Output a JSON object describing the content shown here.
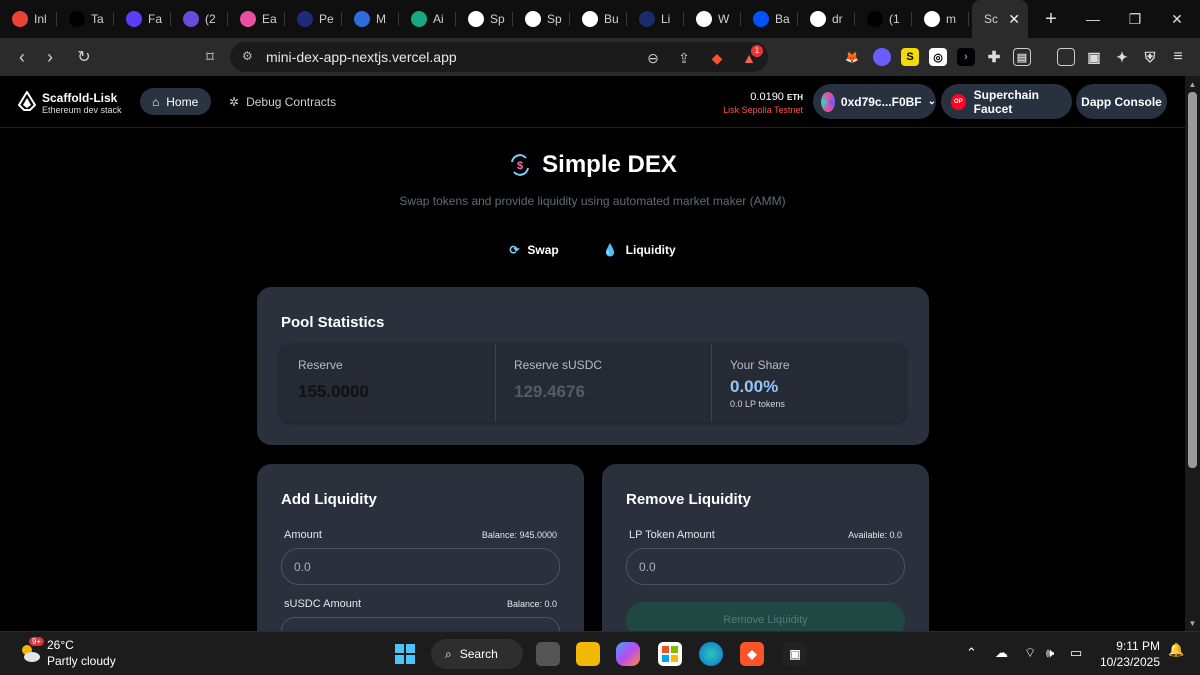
{
  "browser": {
    "tabs": [
      {
        "label": "Inl",
        "icon": "gmail-icon",
        "color": "#ea4335"
      },
      {
        "label": "Ta",
        "icon": "t-icon",
        "color": "#000000"
      },
      {
        "label": "Fa",
        "icon": "n-icon",
        "color": "#5b3df5"
      },
      {
        "label": "(2",
        "icon": "badge-icon",
        "color": "#6a4bd8"
      },
      {
        "label": "Ea",
        "icon": "planet-icon",
        "color": "#e94fa0"
      },
      {
        "label": "Pe",
        "icon": "hf-icon",
        "color": "#1f2a7a"
      },
      {
        "label": "M",
        "icon": "globe-icon",
        "color": "#2d6cdf"
      },
      {
        "label": "Ai",
        "icon": "star-icon",
        "color": "#1aa584"
      },
      {
        "label": "Sp",
        "icon": "lisk-icon",
        "color": "#ffffff"
      },
      {
        "label": "Sp",
        "icon": "lisk-icon",
        "color": "#ffffff"
      },
      {
        "label": "Bu",
        "icon": "lisk-icon",
        "color": "#ffffff"
      },
      {
        "label": "Li",
        "icon": "lisk-icon",
        "color": "#1a2b6b"
      },
      {
        "label": "W",
        "icon": "lisk-icon",
        "color": "#ffffff"
      },
      {
        "label": "Ba",
        "icon": "base-icon",
        "color": "#0052ff"
      },
      {
        "label": "dr",
        "icon": "github-icon",
        "color": "#ffffff"
      },
      {
        "label": "(1",
        "icon": "x-icon",
        "color": "#000000"
      },
      {
        "label": "m",
        "icon": "vercel-icon",
        "color": "#ffffff"
      }
    ],
    "active_tab": {
      "label": "Sc"
    },
    "new_tab": "+",
    "url": "mini-dex-app-nextjs.vercel.app",
    "brave_badge": "1"
  },
  "app": {
    "brand_title": "Scaffold-Lisk",
    "brand_subtitle": "Ethereum dev stack",
    "nav_home": "Home",
    "nav_debug": "Debug Contracts",
    "balance_value": "0.0190",
    "balance_unit": "ETH",
    "network": "Lisk Sepolia Testnet",
    "address": "0xd79c...F0BF",
    "faucet": "Superchain Faucet",
    "faucet_badge": "OP",
    "console": "Dapp Console",
    "colors": {
      "accent": "#2a3441",
      "network": "#ff4d4d",
      "card": "#2a303c",
      "share": "#93c5fd"
    }
  },
  "dex": {
    "title": "Simple DEX",
    "subtitle": "Swap tokens and provide liquidity using automated market maker (AMM)",
    "tab_swap": "Swap",
    "tab_liquidity": "Liquidity"
  },
  "pool": {
    "title": "Pool Statistics",
    "reserve_label": "Reserve",
    "reserve_value": "155.0000",
    "reserve2_label": "Reserve sUSDC",
    "reserve2_value": "129.4676",
    "share_label": "Your Share",
    "share_value": "0.00%",
    "share_sub": "0.0 LP tokens"
  },
  "add": {
    "title": "Add Liquidity",
    "amount_label": "Amount",
    "amount_balance": "Balance: 945.0000",
    "amount_placeholder": "0.0",
    "susdc_label": "sUSDC Amount",
    "susdc_balance": "Balance: 0.0"
  },
  "remove": {
    "title": "Remove Liquidity",
    "lp_label": "LP Token Amount",
    "lp_available": "Available: 0.0",
    "lp_placeholder": "0.0",
    "button": "Remove Liquidity"
  },
  "taskbar": {
    "weather_badge": "9+",
    "temperature": "26°C",
    "condition": "Partly cloudy",
    "search": "Search",
    "time": "9:11 PM",
    "date": "10/23/2025"
  }
}
